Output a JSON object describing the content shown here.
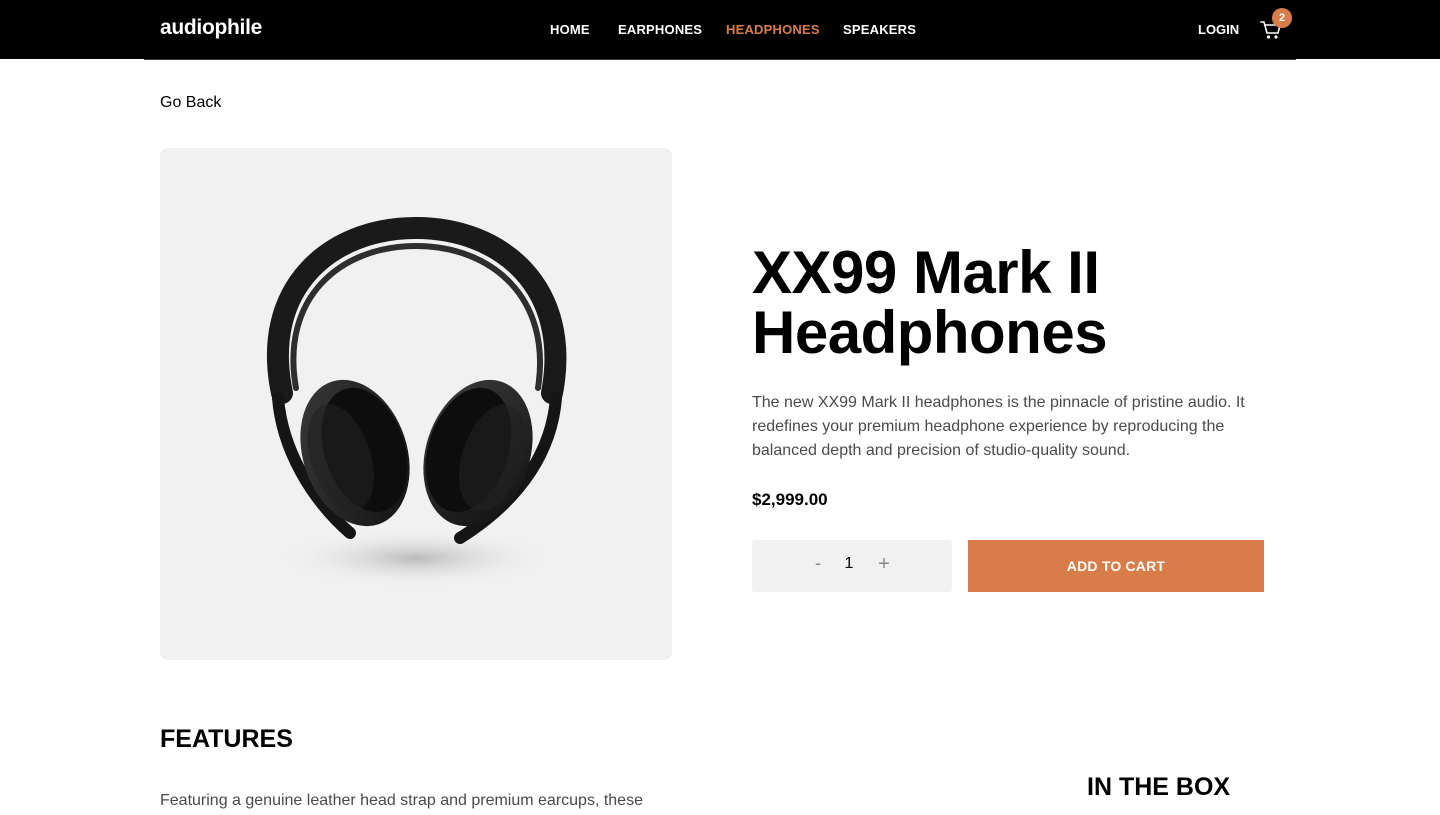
{
  "header": {
    "logo": "audiophile",
    "nav": [
      {
        "label": "HOME",
        "active": false
      },
      {
        "label": "EARPHONES",
        "active": false
      },
      {
        "label": "HEADPHONES",
        "active": true
      },
      {
        "label": "SPEAKERS",
        "active": false
      }
    ],
    "login_label": "LOGIN",
    "cart_count": "2",
    "cart_icon": "cart-icon"
  },
  "go_back_label": "Go Back",
  "product": {
    "image_icon": "headphones-image",
    "name": "XX99 Mark II Headphones",
    "description": "The new XX99 Mark II headphones is the pinnacle of pristine audio. It redefines your premium headphone experience by reproducing the balanced depth and precision of studio-quality sound.",
    "price": "$2,999.00",
    "quantity": {
      "minus_label": "-",
      "value": "1",
      "plus_label": "+"
    },
    "add_to_cart_label": "ADD TO CART"
  },
  "features": {
    "title": "FEATURES",
    "text": "Featuring a genuine leather head strap and premium earcups, these"
  },
  "in_the_box": {
    "title": "IN THE BOX"
  },
  "colors": {
    "accent": "#d87d4a",
    "header_bg": "#000000",
    "panel_bg": "#f1f1f1"
  }
}
